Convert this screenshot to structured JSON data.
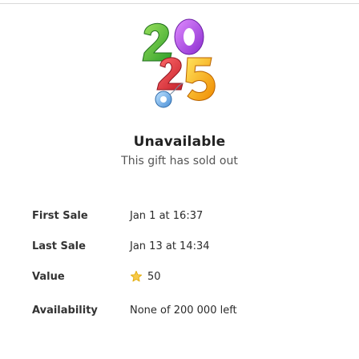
{
  "gift": {
    "sticker_icon": "colorful-number-2025-balloon-icon"
  },
  "status": {
    "title": "Unavailable",
    "subtitle": "This gift has sold out"
  },
  "details": {
    "first_sale": {
      "label": "First Sale",
      "value": "Jan 1 at 16:37"
    },
    "last_sale": {
      "label": "Last Sale",
      "value": "Jan 13 at 14:34"
    },
    "value": {
      "label": "Value",
      "value": "50",
      "icon": "star-icon"
    },
    "availability": {
      "label": "Availability",
      "value": "None of 200 000 left"
    }
  },
  "colors": {
    "star": "#f2b705",
    "title": "#222222",
    "subtitle": "#555555"
  }
}
